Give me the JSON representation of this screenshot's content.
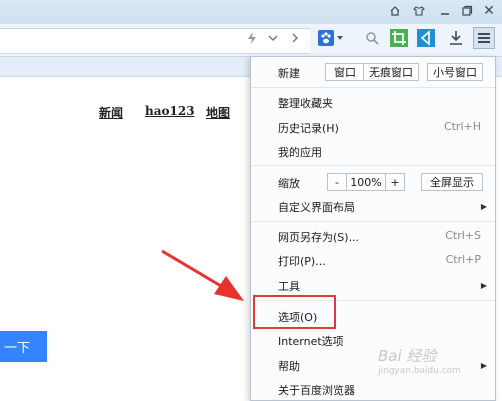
{
  "page": {
    "nav_links": [
      "新闻",
      "hao123",
      "地图"
    ],
    "search_button": "一下"
  },
  "titlebar": {
    "icons": [
      "home-icon",
      "shirt-icon",
      "minimize-icon",
      "restore-icon",
      "close-icon"
    ],
    "close_glyph": "✕"
  },
  "toolbar": {
    "icons": [
      "lightning-icon",
      "chevron-down-icon",
      "chevron-right-icon",
      "paw-icon",
      "search-icon",
      "crop-icon",
      "back-icon",
      "download-icon",
      "menu-icon"
    ]
  },
  "menu": {
    "new_label": "新建",
    "new_window": "窗口",
    "new_incognito": "无痕窗口",
    "new_small": "小号窗口",
    "organize_bookmarks": "整理收藏夹",
    "history": "历史记录(H)",
    "history_shortcut": "Ctrl+H",
    "my_apps": "我的应用",
    "zoom_label": "缩放",
    "zoom_minus": "-",
    "zoom_value": "100%",
    "zoom_plus": "+",
    "fullscreen": "全屏显示",
    "customize_layout": "自定义界面布局",
    "save_as": "网页另存为(S)...",
    "save_shortcut": "Ctrl+S",
    "print": "打印(P)...",
    "print_shortcut": "Ctrl+P",
    "tools": "工具",
    "options": "选项(O)",
    "internet_options": "Internet选项",
    "help": "帮助",
    "about": "关于百度浏览器"
  },
  "watermark": {
    "text": "Bai 经验",
    "url": "jingyan.baidu.com"
  },
  "colors": {
    "accent_blue": "#3385ff",
    "highlight_red": "#e03a3a"
  }
}
